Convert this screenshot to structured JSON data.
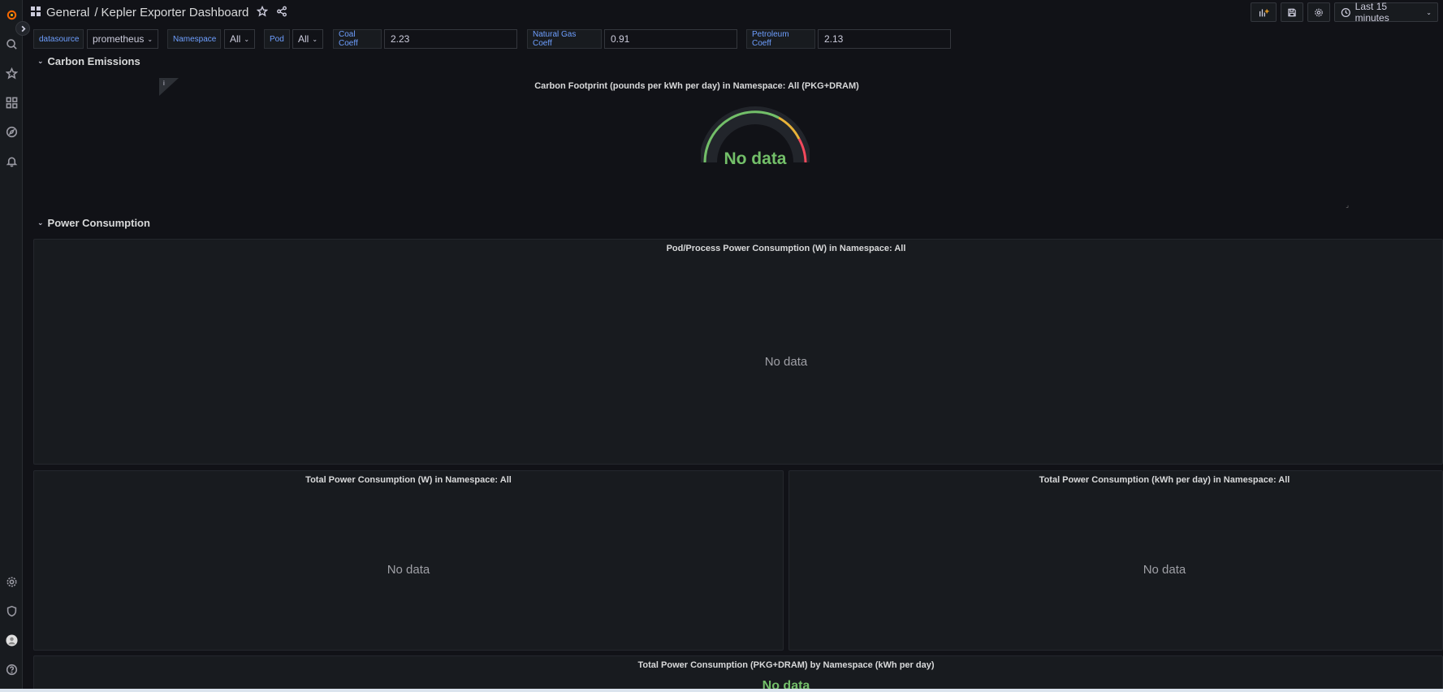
{
  "header": {
    "breadcrumb_folder": "General",
    "breadcrumb_separator": "/",
    "dashboard_title": "Kepler Exporter Dashboard",
    "time_range": "Last 15 minutes"
  },
  "variables": {
    "datasource": {
      "label": "datasource",
      "value": "prometheus"
    },
    "namespace": {
      "label": "Namespace",
      "value": "All"
    },
    "pod": {
      "label": "Pod",
      "value": "All"
    },
    "coal": {
      "label": "Coal Coeff",
      "value": "2.23"
    },
    "natural_gas": {
      "label": "Natural Gas Coeff",
      "value": "0.91"
    },
    "petroleum": {
      "label": "Petroleum Coeff",
      "value": "2.13"
    }
  },
  "rows": {
    "carbon": {
      "title": "Carbon Emissions",
      "gauge_panel": {
        "title": "Carbon Footprint (pounds per kWh per day) in Namespace: All (PKG+DRAM)",
        "value_text": "No data",
        "info_mark": "i",
        "colors": {
          "green": "#73bf69",
          "yellow": "#e8b339",
          "red": "#f2495c"
        }
      }
    },
    "power": {
      "title": "Power Consumption",
      "panels": [
        {
          "title": "Pod/Process Power Consumption (W) in Namespace: All",
          "value_text": "No data"
        },
        {
          "title": "Total Power Consumption (W) in Namespace: All",
          "value_text": "No data"
        },
        {
          "title": "Total Power Consumption (kWh per day) in Namespace: All",
          "value_text": "No data"
        },
        {
          "title": "Total Power Consumption (PKG+DRAM) by Namespace (kWh per day)",
          "value_text": "No data"
        }
      ]
    }
  },
  "icons": {
    "logo": "grafana-logo-icon",
    "search": "search-icon",
    "starred": "star-icon",
    "dashboards": "dashboards-grid-icon",
    "explore": "compass-icon",
    "alerting": "bell-icon",
    "configuration": "gear-icon",
    "server_admin": "shield-icon",
    "profile": "avatar-icon",
    "help": "help-icon"
  }
}
